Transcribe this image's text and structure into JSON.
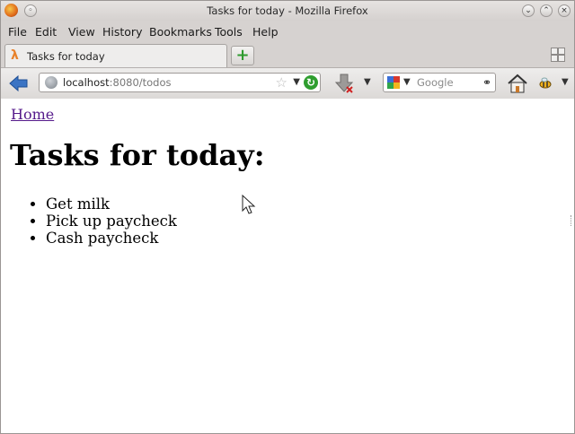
{
  "window": {
    "title": "Tasks for today - Mozilla Firefox"
  },
  "menu": {
    "items": [
      {
        "label": "File"
      },
      {
        "label": "Edit"
      },
      {
        "label": "View"
      },
      {
        "label": "History"
      },
      {
        "label": "Bookmarks"
      },
      {
        "label": "Tools"
      },
      {
        "label": "Help"
      }
    ]
  },
  "tabs": [
    {
      "label": "Tasks for today",
      "icon": "lambda-icon"
    }
  ],
  "navbar": {
    "url_host": "localhost",
    "url_path": ":8080/todos",
    "search_placeholder": "Google"
  },
  "page": {
    "home_link": "Home",
    "heading": "Tasks for today:",
    "tasks": [
      "Get milk",
      "Pick up paycheck",
      "Cash paycheck"
    ]
  },
  "colors": {
    "link_visited": "#551a8b",
    "reload_green": "#2f9e2f",
    "firefox_orange": "#e06a1a"
  }
}
